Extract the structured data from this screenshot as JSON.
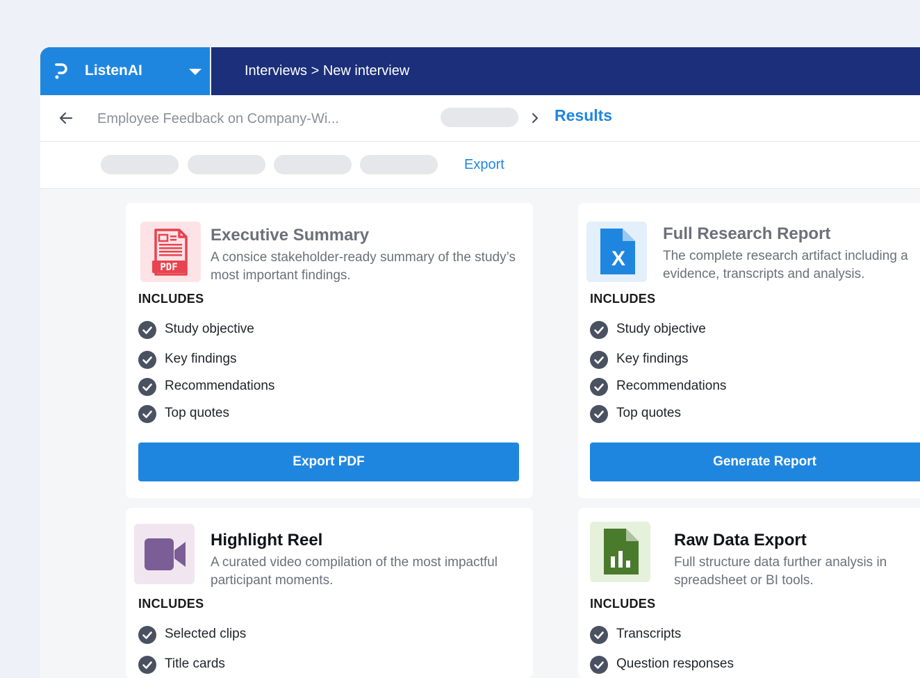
{
  "app": {
    "name": "ListenAI"
  },
  "header": {
    "breadcrumb": "Interviews > New interview"
  },
  "subheader": {
    "study_title": "Employee Feedback on Company-Wi...",
    "current": "Results"
  },
  "tabs": {
    "export_label": "Export"
  },
  "includes_label": "INCLUDES",
  "cards": [
    {
      "title": "Executive Summary",
      "description": "A consice stakeholder-ready summary of the study’s most important findings.",
      "icon": "pdf-file-icon",
      "icon_text": "PDF",
      "items": [
        "Study objective",
        "Key findings",
        "Recommendations",
        "Top quotes"
      ],
      "button": "Export PDF"
    },
    {
      "title": "Full Research Report",
      "description": "The complete research artifact including a evidence, transcripts and analysis.",
      "icon": "excel-file-icon",
      "icon_text": "X",
      "items": [
        "Study objective",
        "Key findings",
        "Recommendations",
        "Top quotes"
      ],
      "button": "Generate Report"
    },
    {
      "title": "Highlight Reel",
      "description": "A curated video compilation of the most impactful participant moments.",
      "icon": "video-camera-icon",
      "items": [
        "Selected clips",
        "Title cards"
      ]
    },
    {
      "title": "Raw Data Export",
      "description": "Full structure data further analysis in spreadsheet or BI tools.",
      "icon": "spreadsheet-chart-icon",
      "items": [
        "Transcripts",
        "Question responses"
      ]
    }
  ],
  "colors": {
    "primary": "#1f86e0",
    "navy": "#1b2f7a",
    "check": "#4a5160"
  }
}
